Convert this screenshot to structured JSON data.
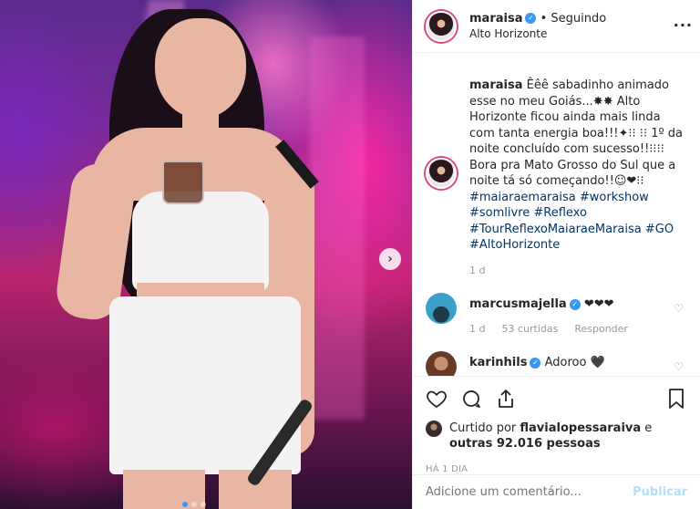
{
  "post": {
    "username": "maraisa",
    "following_label": "Seguindo",
    "location": "Alto Horizonte"
  },
  "caption": {
    "username": "maraisa",
    "text": "Êêê sabadinho animado esse no meu Goiás...✸✸ Alto Horizonte ficou ainda mais linda com tanta energia boa!!!✦⁝⁝ ⁝⁝ 1º da noite concluído com sucesso!!⁝⁝⁝⁝ Bora pra Mato Grosso do Sul que a noite tá só começando!!☺❤⁝⁝",
    "hashtags_line1": "#maiaraemaraisa #workshow",
    "hashtags_line2": "#somlivre #Reflexo",
    "hashtags_line3": "#TourReflexoMaiaraeMaraisa #GO",
    "hashtags_line4": "#AltoHorizonte",
    "time": "1 d"
  },
  "comments": [
    {
      "username": "marcusmajella",
      "text": "❤❤❤",
      "time": "1 d",
      "likes": "53 curtidas",
      "reply": "Responder"
    },
    {
      "username": "karinhils",
      "text": "Adoroo 🖤"
    }
  ],
  "likes": {
    "prefix": "Curtido por ",
    "user": "flavialopessaraiva",
    "middle": " e",
    "others": "outras 92.016 pessoas"
  },
  "posted_ago": "HÁ 1 DIA",
  "comment_box": {
    "placeholder": "Adicione um comentário...",
    "publish_label": "Publicar"
  },
  "colors": {
    "link": "#003569",
    "verified": "#3897f0",
    "publish_disabled": "#b2dffc"
  },
  "icons": [
    "verified-badge-icon",
    "more-options-icon",
    "chevron-right-icon",
    "heart-icon",
    "comment-icon",
    "share-icon",
    "bookmark-icon"
  ]
}
